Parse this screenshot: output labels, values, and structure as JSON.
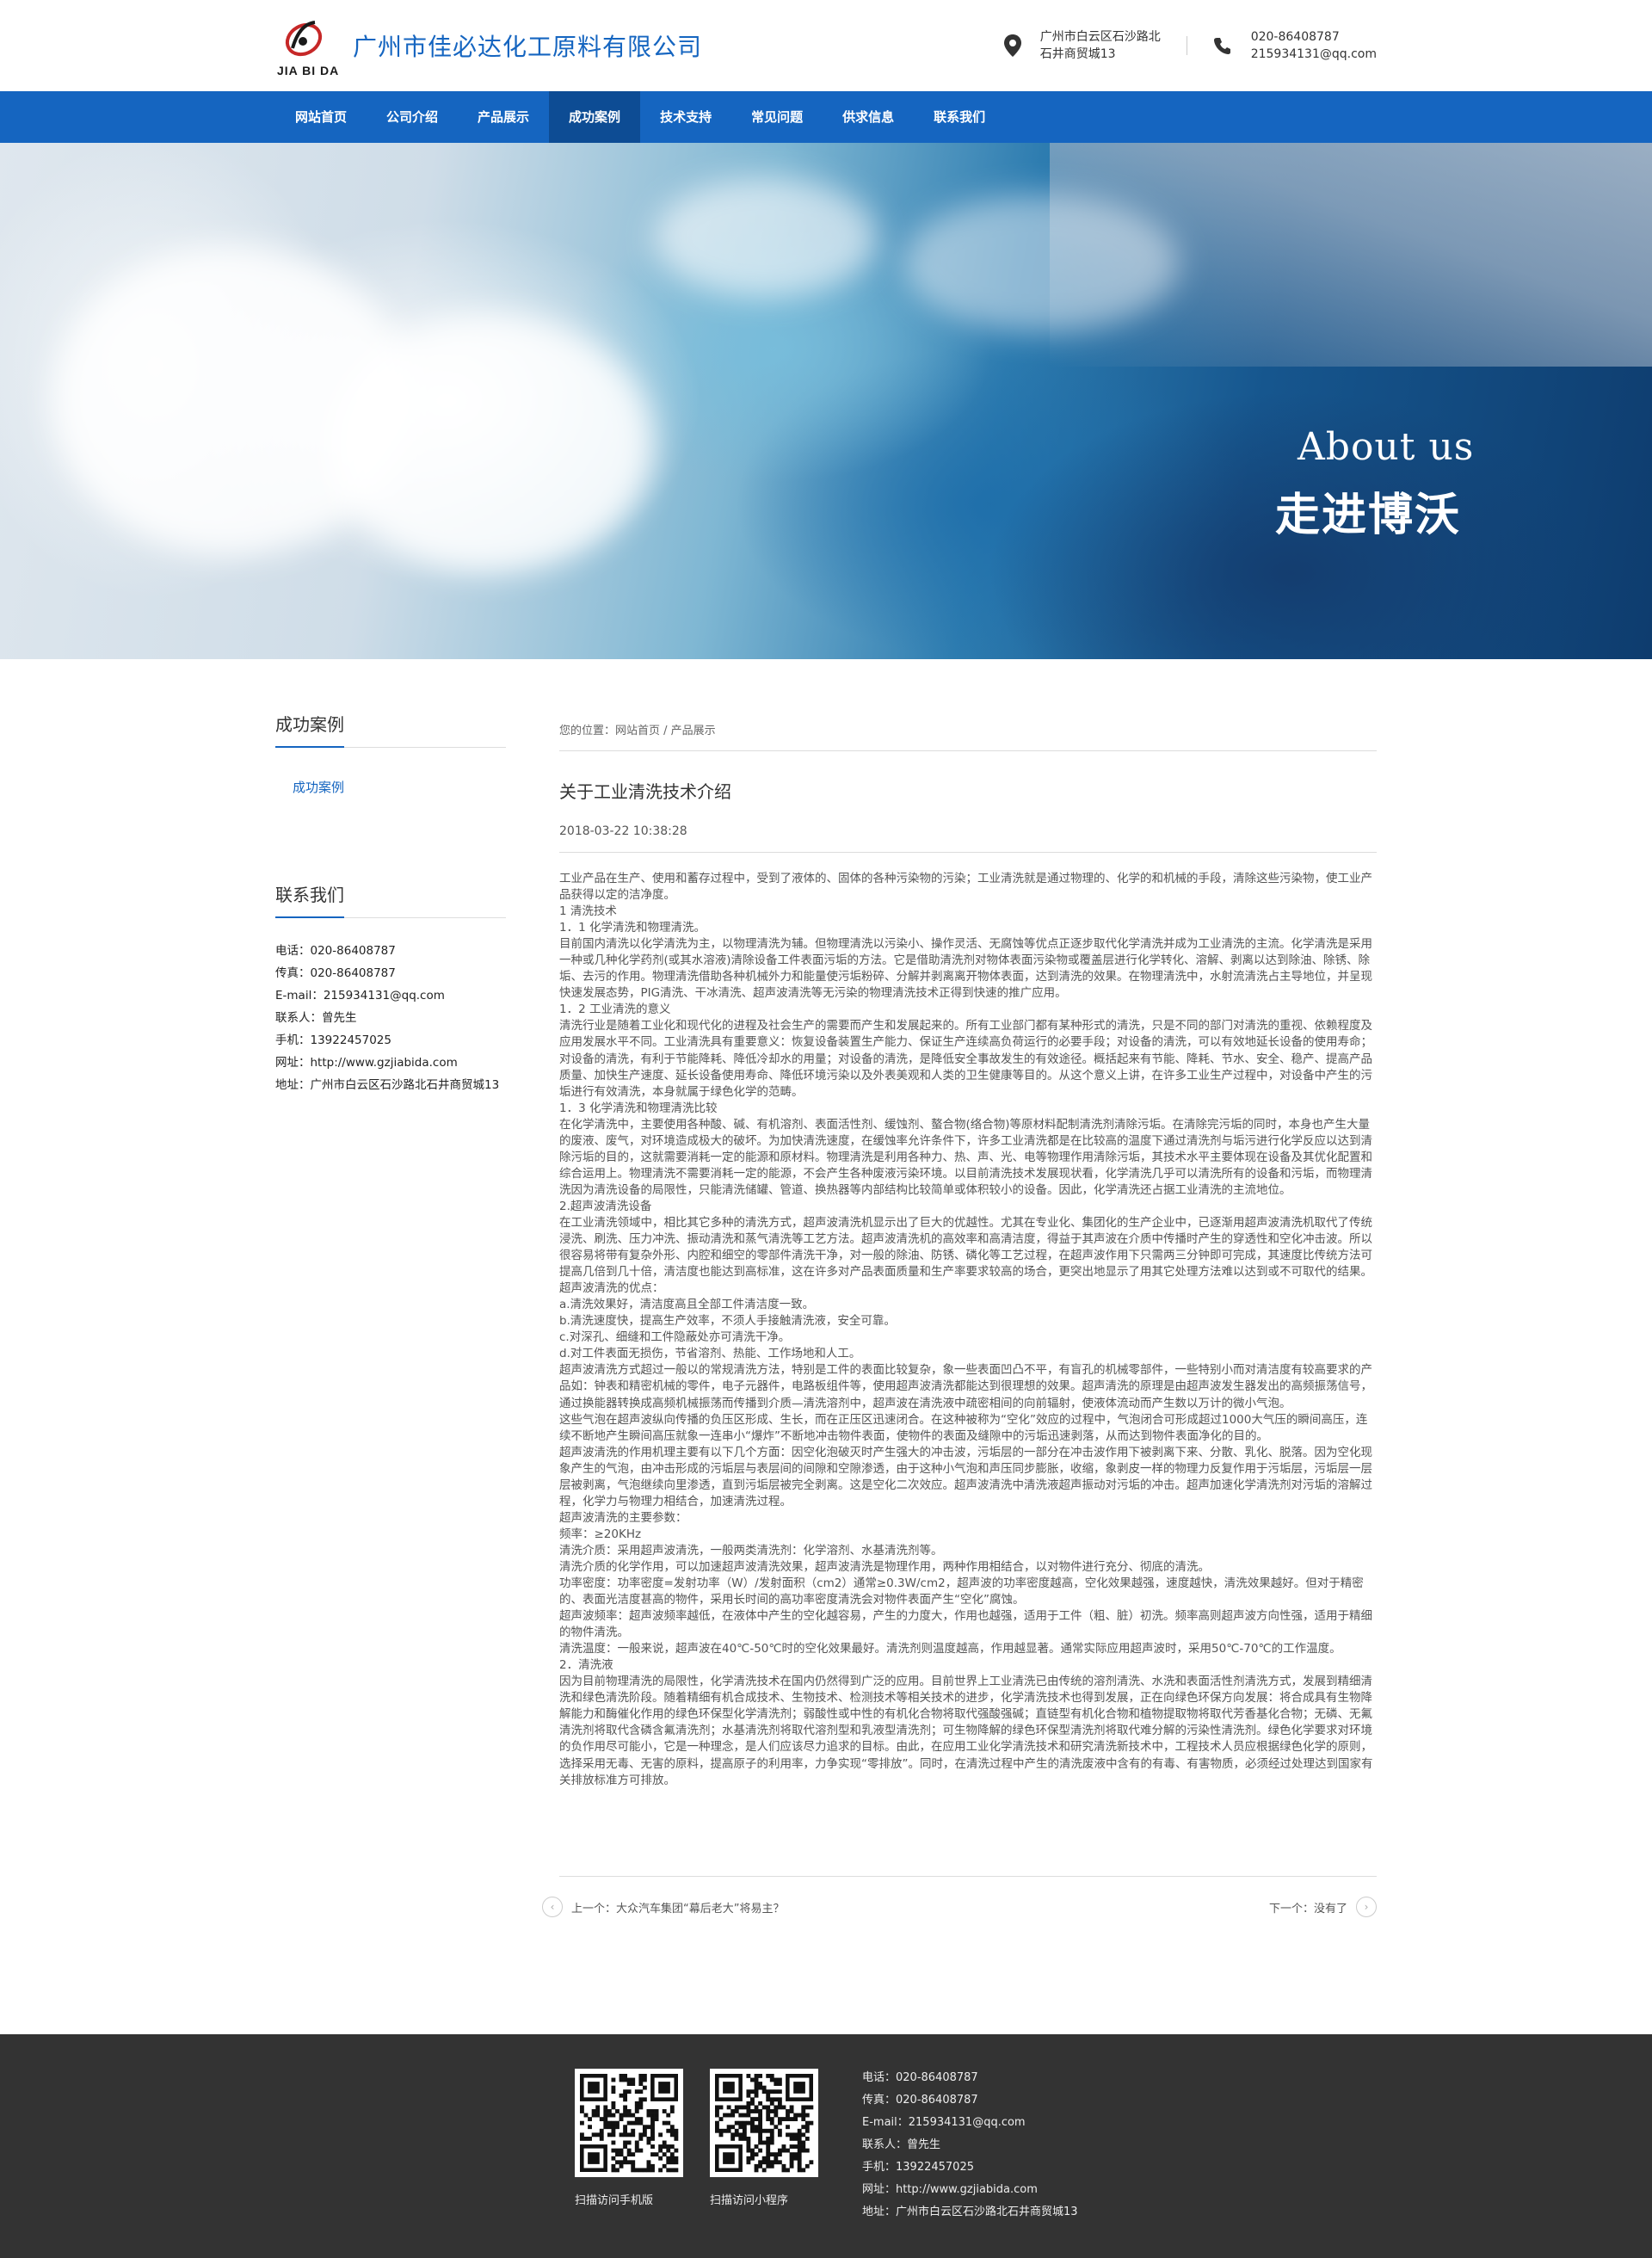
{
  "header": {
    "logo_text": "JIA BI DA",
    "company_name": "广州市佳必达化工原料有限公司",
    "address_line1": "广州市白云区石沙路北",
    "address_line2": "石井商贸城13",
    "phone": "020-86408787",
    "email": "215934131@qq.com",
    "brand_color": "#1565c0"
  },
  "nav": {
    "items": [
      {
        "label": "网站首页"
      },
      {
        "label": "公司介绍"
      },
      {
        "label": "产品展示"
      },
      {
        "label": "成功案例",
        "active": true
      },
      {
        "label": "技术支持"
      },
      {
        "label": "常见问题"
      },
      {
        "label": "供求信息"
      },
      {
        "label": "联系我们"
      }
    ]
  },
  "banner": {
    "title_en": "About us",
    "title_cn": "走进博沃"
  },
  "sidebar": {
    "section_title": "成功案例",
    "links": [
      "成功案例"
    ],
    "contact_title": "联系我们",
    "contact": [
      "电话：020-86408787",
      "传真：020-86408787",
      "E-mail：215934131@qq.com",
      "联系人：曾先生",
      "手机：13922457025",
      "网址：http://www.gzjiabida.com",
      "地址：广州市白云区石沙路北石井商贸城13"
    ]
  },
  "article": {
    "breadcrumb": "您的位置：网站首页 /  产品展示",
    "title": "关于工业清洗技术介绍",
    "date": "2018-03-22 10:38:28",
    "paragraphs": [
      "工业产品在生产、使用和蓄存过程中，受到了液体的、固体的各种污染物的污染；工业清洗就是通过物理的、化学的和机械的手段，清除这些污染物，使工业产品获得以定的洁净度。",
      "1 清洗技术",
      "1．1 化学清洗和物理清洗。",
      "目前国内清洗以化学清洗为主，以物理清洗为辅。但物理清洗以污染小、操作灵活、无腐蚀等优点正逐步取代化学清洗并成为工业清洗的主流。化学清洗是采用一种或几种化学药剂(或其水溶液)清除设备工件表面污垢的方法。它是借助清洗剂对物体表面污染物或覆盖层进行化学转化、溶解、剥离以达到除油、除锈、除垢、去污的作用。物理清洗借助各种机械外力和能量使污垢粉碎、分解并剥离离开物体表面，达到清洗的效果。在物理清洗中，水射流清洗占主导地位，并呈现快速发展态势，PIG清洗、干冰清洗、超声波清洗等无污染的物理清洗技术正得到快速的推广应用。",
      "1．2 工业清洗的意义",
      "清洗行业是随着工业化和现代化的进程及社会生产的需要而产生和发展起来的。所有工业部门都有某种形式的清洗，只是不同的部门对清洗的重视、依赖程度及应用发展水平不同。工业清洗具有重要意义：恢复设备装置生产能力、保证生产连续高负荷运行的必要手段；对设备的清洗，可以有效地延长设备的使用寿命；对设备的清洗，有利于节能降耗、降低冷却水的用量；对设备的清洗，是降低安全事故发生的有效途径。概括起来有节能、降耗、节水、安全、稳产、提高产品质量、加快生产速度、延长设备使用寿命、降低环境污染以及外表美观和人类的卫生健康等目的。从这个意义上讲，在许多工业生产过程中，对设备中产生的污垢进行有效清洗，本身就属于绿色化学的范畴。",
      "1．3 化学清洗和物理清洗比较",
      "在化学清洗中，主要使用各种酸、碱、有机溶剂、表面活性剂、缓蚀剂、螯合物(络合物)等原材料配制清洗剂清除污垢。在清除完污垢的同时，本身也产生大量的废液、废气，对环境造成极大的破坏。为加快清洗速度，在缓蚀率允许条件下，许多工业清洗都是在比较高的温度下通过清洗剂与垢污进行化学反应以达到清除污垢的目的，这就需要消耗一定的能源和原材料。物理清洗是利用各种力、热、声、光、电等物理作用清除污垢，其技术水平主要体现在设备及其优化配置和综合运用上。物理清洗不需要消耗一定的能源，不会产生各种废液污染环境。以目前清洗技术发展现状看，化学清洗几乎可以清洗所有的设备和污垢，而物理清洗因为清洗设备的局限性，只能清洗储罐、管道、换热器等内部结构比较简单或体积较小的设备。因此，化学清洗还占据工业清洗的主流地位。",
      "2.超声波清洗设备",
      "在工业清洗领域中，相比其它多种的清洗方式，超声波清洗机显示出了巨大的优越性。尤其在专业化、集团化的生产企业中，已逐渐用超声波清洗机取代了传统浸洗、刷洗、压力冲洗、振动清洗和蒸气清洗等工艺方法。超声波清洗机的高效率和高清洁度，得益于其声波在介质中传播时产生的穿透性和空化冲击波。所以很容易将带有复杂外形、内腔和细空的零部件清洗干净，对一般的除油、防锈、磷化等工艺过程，在超声波作用下只需两三分钟即可完成，其速度比传统方法可提高几倍到几十倍，清洁度也能达到高标准，这在许多对产品表面质量和生产率要求较高的场合，更突出地显示了用其它处理方法难以达到或不可取代的结果。",
      "超声波清洗的优点：",
      "a.清洗效果好，清洁度高且全部工件清洁度一致。",
      "b.清洗速度快，提高生产效率，不须人手接触清洗液，安全可靠。",
      "c.对深孔、细缝和工件隐蔽处亦可清洗干净。",
      "d.对工件表面无损伤，节省溶剂、热能、工作场地和人工。",
      "超声波清洗方式超过一般以的常规清洗方法，特别是工件的表面比较复杂，象一些表面凹凸不平，有盲孔的机械零部件，一些特别小而对清洁度有较高要求的产品如：钟表和精密机械的零件，电子元器件，电路板组件等，使用超声波清洗都能达到很理想的效果。超声清洗的原理是由超声波发生器发出的高频振荡信号，通过换能器转换成高频机械振荡而传播到介质—清洗溶剂中，超声波在清洗液中疏密相间的向前辐射，使液体流动而产生数以万计的微小气泡。",
      "这些气泡在超声波纵向传播的负压区形成、生长，而在正压区迅速闭合。在这种被称为“空化”效应的过程中，气泡闭合可形成超过1000大气压的瞬间高压，连续不断地产生瞬间高压就象一连串小“爆炸”不断地冲击物件表面，使物件的表面及缝隙中的污垢迅速剥落，从而达到物件表面净化的目的。",
      "超声波清洗的作用机理主要有以下几个方面：因空化泡破灭时产生强大的冲击波，污垢层的一部分在冲击波作用下被剥离下来、分散、乳化、脱落。因为空化现象产生的气泡，由冲击形成的污垢层与表层间的间隙和空隙渗透，由于这种小气泡和声压同步膨胀，收缩，象剥皮一样的物理力反复作用于污垢层，污垢层一层层被剥离，气泡继续向里渗透，直到污垢层被完全剥离。这是空化二次效应。超声波清洗中清洗液超声振动对污垢的冲击。超声加速化学清洗剂对污垢的溶解过程，化学力与物理力相结合，加速清洗过程。",
      "超声波清洗的主要参数：",
      "频率：≥20KHz",
      "清洗介质：采用超声波清洗，一般两类清洗剂：化学溶剂、水基清洗剂等。",
      "清洗介质的化学作用，可以加速超声波清洗效果，超声波清洗是物理作用，两种作用相结合，以对物件进行充分、彻底的清洗。",
      "功率密度：功率密度=发射功率（W）/发射面积（cm2）通常≥0.3W/cm2，超声波的功率密度越高，空化效果越强，速度越快，清洗效果越好。但对于精密的、表面光洁度甚高的物件，采用长时间的高功率密度清洗会对物件表面产生“空化”腐蚀。",
      "超声波频率：超声波频率越低，在液体中产生的空化越容易，产生的力度大，作用也越强，适用于工件（粗、脏）初洗。频率高则超声波方向性强，适用于精细的物件清洗。",
      "清洗温度：一般来说，超声波在40℃-50℃时的空化效果最好。清洗剂则温度越高，作用越显著。通常实际应用超声波时，采用50℃-70℃的工作温度。",
      "2．清洗液",
      "因为目前物理清洗的局限性，化学清洗技术在国内仍然得到广泛的应用。目前世界上工业清洗已由传统的溶剂清洗、水洗和表面活性剂清洗方式，发展到精细清洗和绿色清洗阶段。随着精细有机合成技术、生物技术、检测技术等相关技术的进步，化学清洗技术也得到发展，正在向绿色环保方向发展：将合成具有生物降解能力和酶催化作用的绿色环保型化学清洗剂；弱酸性或中性的有机化合物将取代强酸强碱；直链型有机化合物和植物提取物将取代芳香基化合物；无磷、无氟清洗剂将取代含磷含氟清洗剂；水基清洗剂将取代溶剂型和乳液型清洗剂；可生物降解的绿色环保型清洗剂将取代难分解的污染性清洗剂。绿色化学要求对环境的负作用尽可能小，它是一种理念，是人们应该尽力追求的目标。由此，在应用工业化学清洗技术和研究清洗新技术中，工程技术人员应根据绿色化学的原则，选择采用无毒、无害的原料，提高原子的利用率，力争实现“零排放”。同时，在清洗过程中产生的清洗废液中含有的有毒、有害物质，必须经过处理达到国家有关排放标准方可排放。"
    ],
    "prev_label": "上一个：大众汽车集团“幕后老大”将易主？",
    "next_label": "下一个：没有了"
  },
  "footer": {
    "qr1_caption": "扫描访问手机版",
    "qr2_caption": "扫描访问小程序",
    "contact": [
      "电话：020-86408787",
      "传真：020-86408787",
      "E-mail：215934131@qq.com",
      "联系人：曾先生",
      "手机：13922457025",
      "网址：http://www.gzjiabida.com",
      "地址：广州市白云区石沙路北石井商贸城13"
    ],
    "bg_color": "#333333"
  },
  "icons": [
    "location-pin-icon",
    "phone-icon",
    "chevron-left-icon",
    "chevron-right-icon",
    "qr-code-icon"
  ]
}
